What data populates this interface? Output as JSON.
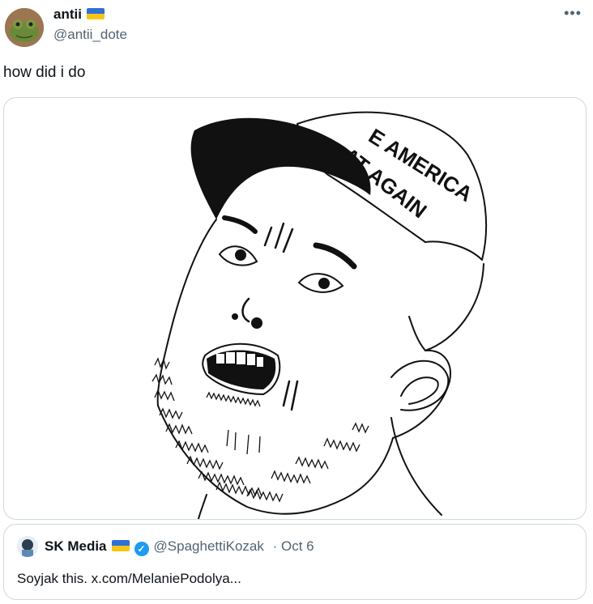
{
  "tweet": {
    "display_name": "antii",
    "handle": "@antii_dote",
    "text": "how did i do",
    "more_icon": "more-icon"
  },
  "media": {
    "cap_text_line1": "E AMERICA",
    "cap_text_line2": "AT AGAIN"
  },
  "quote": {
    "display_name": "SK Media",
    "handle": "@SpaghettiKozak",
    "date": "· Oct 6",
    "text": "Soyjak this. x.com/MelaniePodolya..."
  }
}
